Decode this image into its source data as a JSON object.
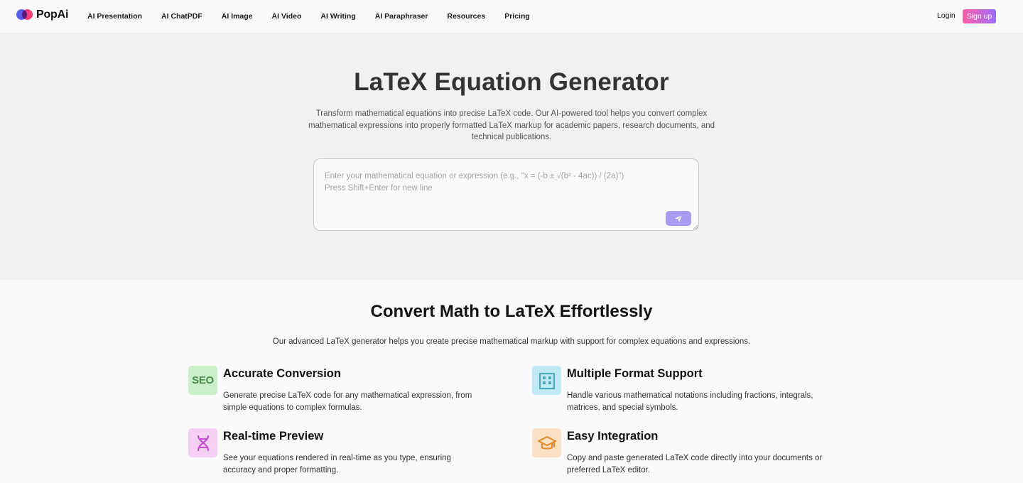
{
  "nav": {
    "brand": "PopAi",
    "items": [
      {
        "label": "AI Presentation"
      },
      {
        "label": "AI ChatPDF"
      },
      {
        "label": "AI Image"
      },
      {
        "label": "AI Video"
      },
      {
        "label": "AI Writing"
      },
      {
        "label": "AI Paraphraser"
      },
      {
        "label": "Resources"
      },
      {
        "label": "Pricing"
      }
    ],
    "login": "Login",
    "signup": "Sign up"
  },
  "hero": {
    "title": "LaTeX Equation Generator",
    "description": "Transform mathematical equations into precise LaTeX code. Our AI-powered tool helps you convert complex mathematical expressions into properly formatted LaTeX markup for academic papers, research documents, and technical publications.",
    "input": {
      "placeholder": "Enter your mathematical equation or expression (e.g., \"x = (-b ± √(b² - 4ac)) / (2a)\")\nPress Shift+Enter for new line",
      "value": ""
    },
    "send_icon": "paper-plane-icon"
  },
  "features": {
    "title": "Convert Math to LaTeX Effortlessly",
    "description": "Our advanced LaTeX generator helps you create precise mathematical markup with support for complex equations and expressions.",
    "items": [
      {
        "title": "Accurate Conversion",
        "description": "Generate precise LaTeX code for any mathematical expression, from simple equations to complex formulas.",
        "icon": "seo-icon",
        "icon_text": "SEO",
        "icon_bg": "#c9f0c9"
      },
      {
        "title": "Multiple Format Support",
        "description": "Handle various mathematical notations including fractions, integrals, matrices, and special symbols.",
        "icon": "building-icon",
        "icon_bg": "#bfe9f3"
      },
      {
        "title": "Real-time Preview",
        "description": "See your equations rendered in real-time as you type, ensuring accuracy and proper formatting.",
        "icon": "dna-icon",
        "icon_bg": "#f4d1f4"
      },
      {
        "title": "Easy Integration",
        "description": "Copy and paste generated LaTeX code directly into your documents or preferred LaTeX editor.",
        "icon": "graduation-cap-icon",
        "icon_bg": "#fbe0c4"
      }
    ]
  },
  "colors": {
    "accent": "#a99bf2",
    "signup_gradient_start": "#ff5fa2",
    "signup_gradient_end": "#9b6cff"
  }
}
